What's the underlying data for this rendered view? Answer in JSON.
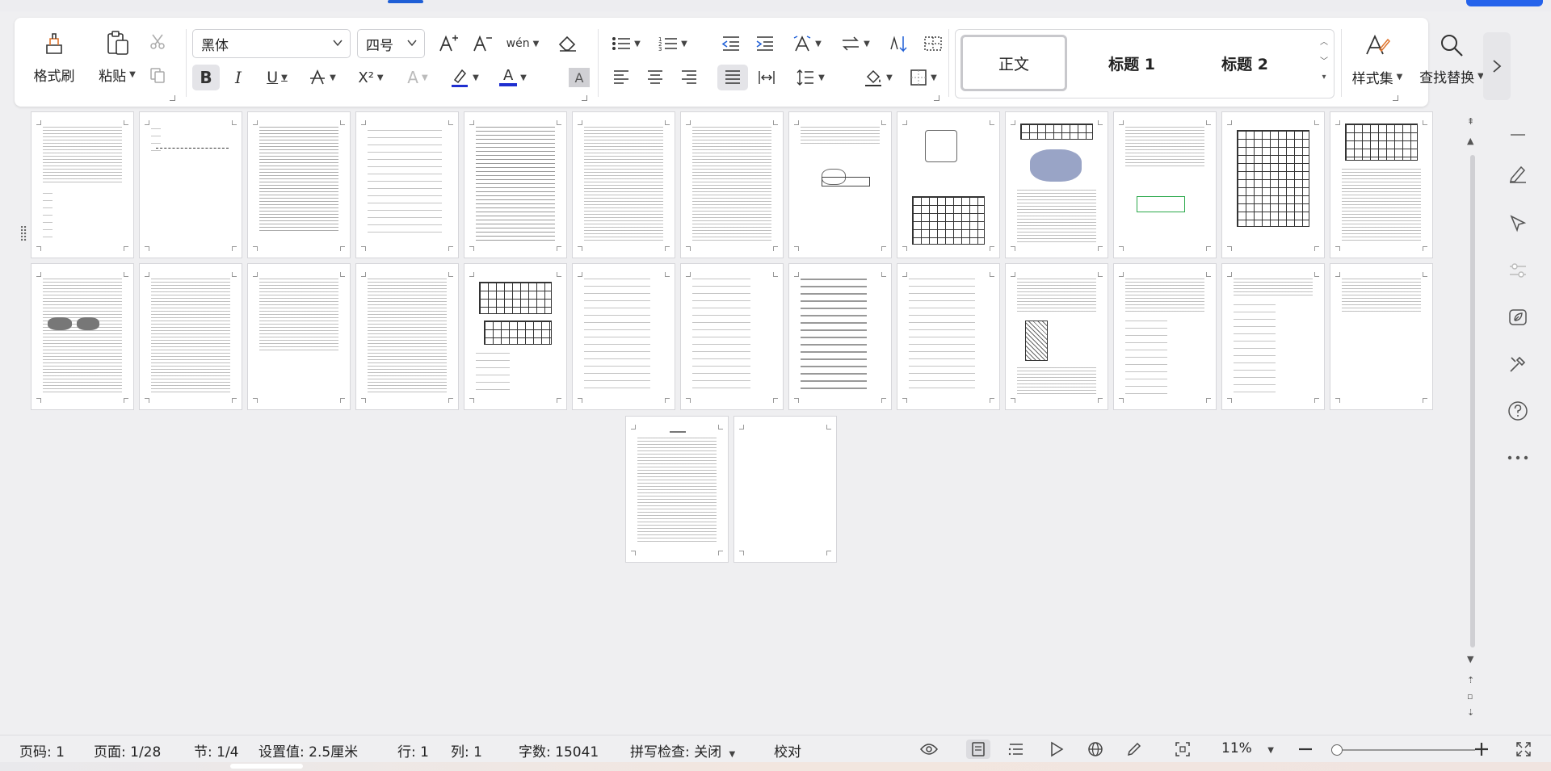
{
  "ribbon": {
    "format_painter": "格式刷",
    "paste": "粘贴",
    "font_name": "黑体",
    "font_size": "四号",
    "styles": [
      "正文",
      "标题 1",
      "标题 2"
    ],
    "style_set": "样式集",
    "find_replace": "查找替换",
    "bold": "B",
    "italic": "I",
    "underline": "U",
    "superscript": "X²",
    "font_color_glyph": "A",
    "font_color": "#1f2fd0",
    "highlight_color": "#1f2fd0",
    "shade_glyph": "A",
    "phonetic_glyph": "wén",
    "text_effect_glyph": "A"
  },
  "status": {
    "page_code": "页码: 1",
    "page": "页面: 1/28",
    "section": "节: 1/4",
    "setting": "设置值: 2.5厘米",
    "row": "行: 1",
    "col": "列: 1",
    "word_count": "字数: 15041",
    "spell_check": "拼写检查: 关闭",
    "proofread": "校对",
    "zoom": "11%"
  },
  "pages": {
    "total": 28
  }
}
